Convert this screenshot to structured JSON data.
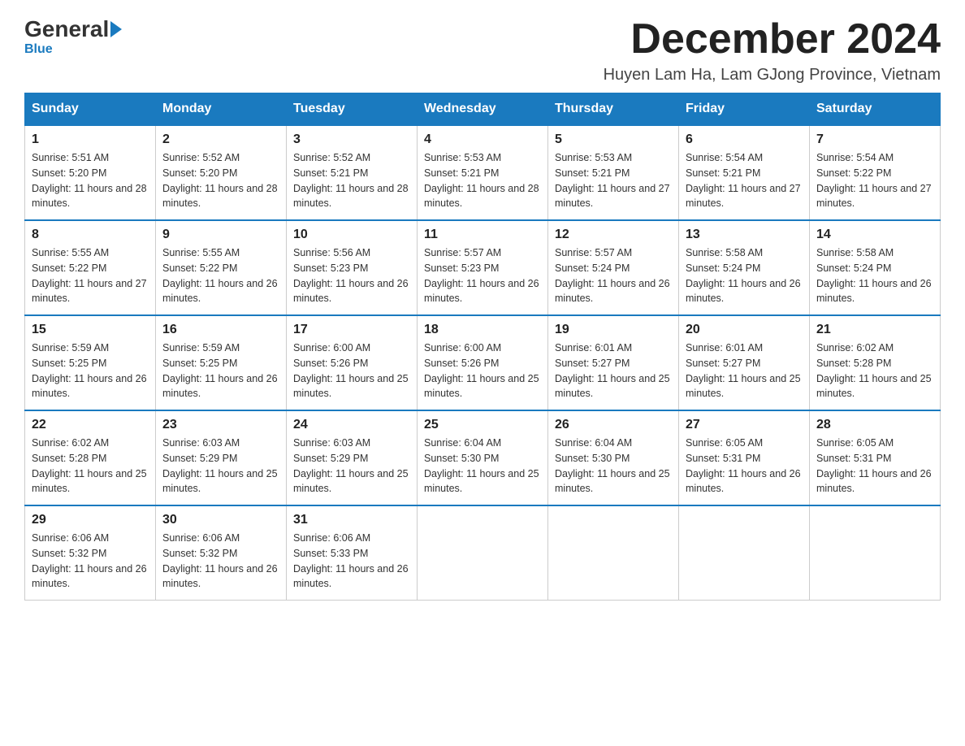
{
  "logo": {
    "text_general": "General",
    "text_blue": "Blue"
  },
  "header": {
    "title": "December 2024",
    "location": "Huyen Lam Ha, Lam GJong Province, Vietnam"
  },
  "days_of_week": [
    "Sunday",
    "Monday",
    "Tuesday",
    "Wednesday",
    "Thursday",
    "Friday",
    "Saturday"
  ],
  "weeks": [
    [
      {
        "day": "1",
        "sunrise": "5:51 AM",
        "sunset": "5:20 PM",
        "daylight": "11 hours and 28 minutes."
      },
      {
        "day": "2",
        "sunrise": "5:52 AM",
        "sunset": "5:20 PM",
        "daylight": "11 hours and 28 minutes."
      },
      {
        "day": "3",
        "sunrise": "5:52 AM",
        "sunset": "5:21 PM",
        "daylight": "11 hours and 28 minutes."
      },
      {
        "day": "4",
        "sunrise": "5:53 AM",
        "sunset": "5:21 PM",
        "daylight": "11 hours and 28 minutes."
      },
      {
        "day": "5",
        "sunrise": "5:53 AM",
        "sunset": "5:21 PM",
        "daylight": "11 hours and 27 minutes."
      },
      {
        "day": "6",
        "sunrise": "5:54 AM",
        "sunset": "5:21 PM",
        "daylight": "11 hours and 27 minutes."
      },
      {
        "day": "7",
        "sunrise": "5:54 AM",
        "sunset": "5:22 PM",
        "daylight": "11 hours and 27 minutes."
      }
    ],
    [
      {
        "day": "8",
        "sunrise": "5:55 AM",
        "sunset": "5:22 PM",
        "daylight": "11 hours and 27 minutes."
      },
      {
        "day": "9",
        "sunrise": "5:55 AM",
        "sunset": "5:22 PM",
        "daylight": "11 hours and 26 minutes."
      },
      {
        "day": "10",
        "sunrise": "5:56 AM",
        "sunset": "5:23 PM",
        "daylight": "11 hours and 26 minutes."
      },
      {
        "day": "11",
        "sunrise": "5:57 AM",
        "sunset": "5:23 PM",
        "daylight": "11 hours and 26 minutes."
      },
      {
        "day": "12",
        "sunrise": "5:57 AM",
        "sunset": "5:24 PM",
        "daylight": "11 hours and 26 minutes."
      },
      {
        "day": "13",
        "sunrise": "5:58 AM",
        "sunset": "5:24 PM",
        "daylight": "11 hours and 26 minutes."
      },
      {
        "day": "14",
        "sunrise": "5:58 AM",
        "sunset": "5:24 PM",
        "daylight": "11 hours and 26 minutes."
      }
    ],
    [
      {
        "day": "15",
        "sunrise": "5:59 AM",
        "sunset": "5:25 PM",
        "daylight": "11 hours and 26 minutes."
      },
      {
        "day": "16",
        "sunrise": "5:59 AM",
        "sunset": "5:25 PM",
        "daylight": "11 hours and 26 minutes."
      },
      {
        "day": "17",
        "sunrise": "6:00 AM",
        "sunset": "5:26 PM",
        "daylight": "11 hours and 25 minutes."
      },
      {
        "day": "18",
        "sunrise": "6:00 AM",
        "sunset": "5:26 PM",
        "daylight": "11 hours and 25 minutes."
      },
      {
        "day": "19",
        "sunrise": "6:01 AM",
        "sunset": "5:27 PM",
        "daylight": "11 hours and 25 minutes."
      },
      {
        "day": "20",
        "sunrise": "6:01 AM",
        "sunset": "5:27 PM",
        "daylight": "11 hours and 25 minutes."
      },
      {
        "day": "21",
        "sunrise": "6:02 AM",
        "sunset": "5:28 PM",
        "daylight": "11 hours and 25 minutes."
      }
    ],
    [
      {
        "day": "22",
        "sunrise": "6:02 AM",
        "sunset": "5:28 PM",
        "daylight": "11 hours and 25 minutes."
      },
      {
        "day": "23",
        "sunrise": "6:03 AM",
        "sunset": "5:29 PM",
        "daylight": "11 hours and 25 minutes."
      },
      {
        "day": "24",
        "sunrise": "6:03 AM",
        "sunset": "5:29 PM",
        "daylight": "11 hours and 25 minutes."
      },
      {
        "day": "25",
        "sunrise": "6:04 AM",
        "sunset": "5:30 PM",
        "daylight": "11 hours and 25 minutes."
      },
      {
        "day": "26",
        "sunrise": "6:04 AM",
        "sunset": "5:30 PM",
        "daylight": "11 hours and 25 minutes."
      },
      {
        "day": "27",
        "sunrise": "6:05 AM",
        "sunset": "5:31 PM",
        "daylight": "11 hours and 26 minutes."
      },
      {
        "day": "28",
        "sunrise": "6:05 AM",
        "sunset": "5:31 PM",
        "daylight": "11 hours and 26 minutes."
      }
    ],
    [
      {
        "day": "29",
        "sunrise": "6:06 AM",
        "sunset": "5:32 PM",
        "daylight": "11 hours and 26 minutes."
      },
      {
        "day": "30",
        "sunrise": "6:06 AM",
        "sunset": "5:32 PM",
        "daylight": "11 hours and 26 minutes."
      },
      {
        "day": "31",
        "sunrise": "6:06 AM",
        "sunset": "5:33 PM",
        "daylight": "11 hours and 26 minutes."
      },
      null,
      null,
      null,
      null
    ]
  ]
}
